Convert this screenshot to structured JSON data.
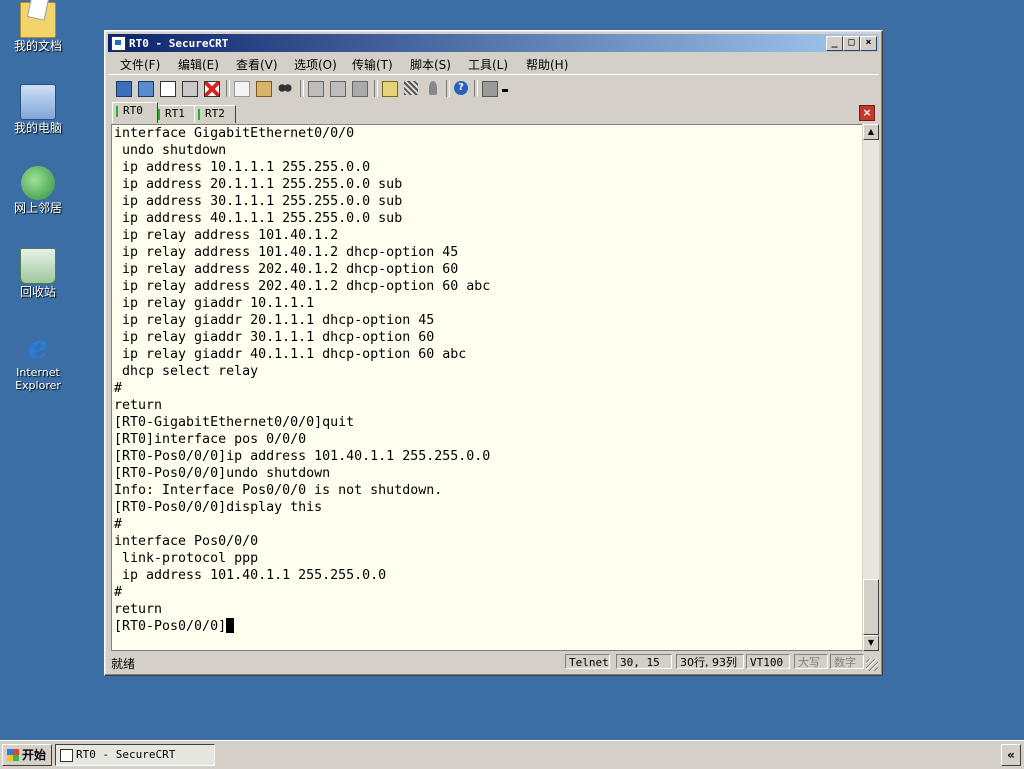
{
  "desktop": {
    "icons": [
      {
        "label": "我的文档",
        "icon": "my-documents-icon"
      },
      {
        "label": "我的电脑",
        "icon": "my-computer-icon"
      },
      {
        "label": "网上邻居",
        "icon": "network-places-icon"
      },
      {
        "label": "回收站",
        "icon": "recycle-bin-icon"
      },
      {
        "label": "Internet Explorer",
        "label_line1": "Internet",
        "label_line2": "Explorer",
        "icon": "internet-explorer-icon"
      }
    ]
  },
  "window": {
    "title": "RT0 - SecureCRT",
    "controls": {
      "minimize": "_",
      "maximize": "□",
      "close": "×"
    },
    "menu": [
      "文件(F)",
      "编辑(E)",
      "查看(V)",
      "选项(O)",
      "传输(T)",
      "脚本(S)",
      "工具(L)",
      "帮助(H)"
    ],
    "toolbar_icons": [
      "connect-icon",
      "quick-connect-icon",
      "connect-tab-icon",
      "reconnect-icon",
      "disconnect-icon",
      "copy-icon",
      "paste-icon",
      "find-icon",
      "print-icon",
      "print-setup-icon",
      "print-selection-icon",
      "session-options-icon",
      "global-options-icon",
      "keymap-icon",
      "help-icon",
      "sftp-icon",
      "more-icon"
    ],
    "tabs": [
      {
        "label": "RT0",
        "active": true
      },
      {
        "label": "RT1",
        "active": false
      },
      {
        "label": "RT2",
        "active": false
      }
    ],
    "tab_close": "×",
    "terminal_lines": [
      "interface GigabitEthernet0/0/0",
      " undo shutdown",
      " ip address 10.1.1.1 255.255.0.0",
      " ip address 20.1.1.1 255.255.0.0 sub",
      " ip address 30.1.1.1 255.255.0.0 sub",
      " ip address 40.1.1.1 255.255.0.0 sub",
      " ip relay address 101.40.1.2",
      " ip relay address 101.40.1.2 dhcp-option 45",
      " ip relay address 202.40.1.2 dhcp-option 60",
      " ip relay address 202.40.1.2 dhcp-option 60 abc",
      " ip relay giaddr 10.1.1.1",
      " ip relay giaddr 20.1.1.1 dhcp-option 45",
      " ip relay giaddr 30.1.1.1 dhcp-option 60",
      " ip relay giaddr 40.1.1.1 dhcp-option 60 abc",
      " dhcp select relay",
      "#",
      "return",
      "[RT0-GigabitEthernet0/0/0]quit",
      "[RT0]interface pos 0/0/0",
      "[RT0-Pos0/0/0]ip address 101.40.1.1 255.255.0.0",
      "[RT0-Pos0/0/0]undo shutdown",
      "Info: Interface Pos0/0/0 is not shutdown.",
      "[RT0-Pos0/0/0]display this",
      "#",
      "interface Pos0/0/0",
      " link-protocol ppp",
      " ip address 101.40.1.1 255.255.0.0",
      "#",
      "return",
      "[RT0-Pos0/0/0]"
    ],
    "status": {
      "ready": "就绪",
      "protocol": "Telnet",
      "cursor_pos": "30,  15",
      "size": "30行, 93列",
      "emulation": "VT100",
      "caps": "大写",
      "num": "数字"
    }
  },
  "taskbar": {
    "start_label": "开始",
    "task_title": "RT0 - SecureCRT",
    "tray_toggle": "«"
  }
}
